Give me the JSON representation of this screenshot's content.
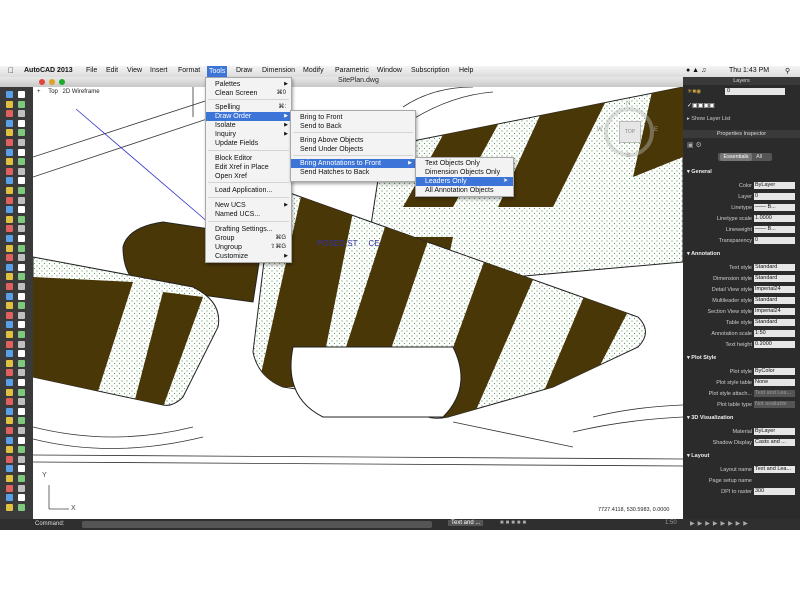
{
  "menubar": {
    "app": "AutoCAD 2013",
    "items": [
      "File",
      "Edit",
      "View",
      "Insert",
      "Format",
      "Tools",
      "Draw",
      "Dimension",
      "Modify",
      "Parametric",
      "Window",
      "Subscription",
      "Help"
    ],
    "active": "Tools",
    "clock": "Thu 1:43 PM"
  },
  "window": {
    "title": "SitePlan.dwg"
  },
  "viewport": {
    "view_label": "Top",
    "visual_style": "2D Wireframe",
    "text_fragment": "POSED ST     CE"
  },
  "viewcube": {
    "n": "N",
    "s": "S",
    "e": "E",
    "w": "W",
    "face": "TOP"
  },
  "tools_menu": [
    {
      "label": "Palettes",
      "shortcut": "",
      "arrow": true
    },
    {
      "label": "Clean Screen",
      "shortcut": "⌘0",
      "arrow": false
    },
    {
      "label": "Spelling",
      "shortcut": "⌘:",
      "arrow": false
    },
    {
      "label": "Draw Order",
      "shortcut": "",
      "arrow": true,
      "selected": true
    },
    {
      "label": "Isolate",
      "shortcut": "",
      "arrow": true
    },
    {
      "label": "Inquiry",
      "shortcut": "",
      "arrow": true
    },
    {
      "label": "Update Fields",
      "shortcut": "",
      "arrow": false
    },
    {
      "label": "Block Editor",
      "shortcut": "",
      "arrow": false
    },
    {
      "label": "Edit Xref in Place",
      "shortcut": "",
      "arrow": false
    },
    {
      "label": "Open Xref",
      "shortcut": "",
      "arrow": false
    },
    {
      "label": "Load Application...",
      "shortcut": "",
      "arrow": false
    },
    {
      "label": "New UCS",
      "shortcut": "",
      "arrow": true
    },
    {
      "label": "Named UCS...",
      "shortcut": "",
      "arrow": false
    },
    {
      "label": "Drafting Settings...",
      "shortcut": "",
      "arrow": false
    },
    {
      "label": "Group",
      "shortcut": "⌘G",
      "arrow": false
    },
    {
      "label": "Ungroup",
      "shortcut": "⇧⌘G",
      "arrow": false
    },
    {
      "label": "Customize",
      "shortcut": "",
      "arrow": true
    }
  ],
  "draworder_menu": [
    {
      "label": "Bring to Front",
      "arrow": false
    },
    {
      "label": "Send to Back",
      "arrow": false
    },
    {
      "label": "Bring Above Objects",
      "arrow": false
    },
    {
      "label": "Send Under Objects",
      "arrow": false
    },
    {
      "label": "Bring Annotations to Front",
      "arrow": true,
      "selected": true
    },
    {
      "label": "Send Hatches to Back",
      "arrow": false
    }
  ],
  "annotations_menu": [
    {
      "label": "Text Objects Only"
    },
    {
      "label": "Dimension Objects Only"
    },
    {
      "label": "Leaders Only",
      "selected": true
    },
    {
      "label": "All Annotation Objects"
    }
  ],
  "layers_panel": {
    "title": "Layers",
    "layer_value": "0",
    "show_layer_list": "Show Layer List"
  },
  "properties": {
    "title": "Properties Inspector",
    "tabs": [
      "Essentials",
      "All"
    ],
    "sections": [
      {
        "name": "General",
        "rows": [
          {
            "label": "Color",
            "value": "ByLayer"
          },
          {
            "label": "Layer",
            "value": "0"
          },
          {
            "label": "Linetype",
            "value": "—— B..."
          },
          {
            "label": "Linetype scale",
            "value": "1.0000"
          },
          {
            "label": "Lineweight",
            "value": "—— B..."
          },
          {
            "label": "Transparency",
            "value": "0"
          }
        ]
      },
      {
        "name": "Annotation",
        "rows": [
          {
            "label": "Text style",
            "value": "Standard"
          },
          {
            "label": "Dimension style",
            "value": "Standard"
          },
          {
            "label": "Detail View style",
            "value": "Imperial24"
          },
          {
            "label": "Multileader style",
            "value": "Standard"
          },
          {
            "label": "Section View style",
            "value": "Imperial24"
          },
          {
            "label": "Table style",
            "value": "Standard"
          },
          {
            "label": "Annotation scale",
            "value": "1:50"
          },
          {
            "label": "Text height",
            "value": "0.2000"
          }
        ]
      },
      {
        "name": "Plot Style",
        "rows": [
          {
            "label": "Plot style",
            "value": "ByColor"
          },
          {
            "label": "Plot style table",
            "value": "None"
          },
          {
            "label": "Plot style attach...",
            "value": "Text and Lea...",
            "disabled": true
          },
          {
            "label": "Plot table type",
            "value": "Not available",
            "disabled": true
          }
        ]
      },
      {
        "name": "3D Visualization",
        "rows": [
          {
            "label": "Material",
            "value": "ByLayer"
          },
          {
            "label": "Shadow Display",
            "value": "Casts and ..."
          }
        ]
      },
      {
        "name": "Layout",
        "rows": [
          {
            "label": "Layout name",
            "value": "Text and Lea..."
          },
          {
            "label": "Page setup name",
            "value": ""
          },
          {
            "label": "DPI to raster",
            "value": "300"
          }
        ]
      }
    ]
  },
  "status": {
    "coordinates": "7727.4118, 530.5983, 0.0000",
    "command_label": "Command:",
    "layout_tab": "Text and ...",
    "scale": "1:50"
  },
  "ucs": {
    "x": "X",
    "y": "Y"
  },
  "colors": {
    "hatch_dark": "#4a3708",
    "hatch_dots": "#5e9a5e",
    "selection": "#3d74d8",
    "panel_bg": "#2b2b2b"
  }
}
